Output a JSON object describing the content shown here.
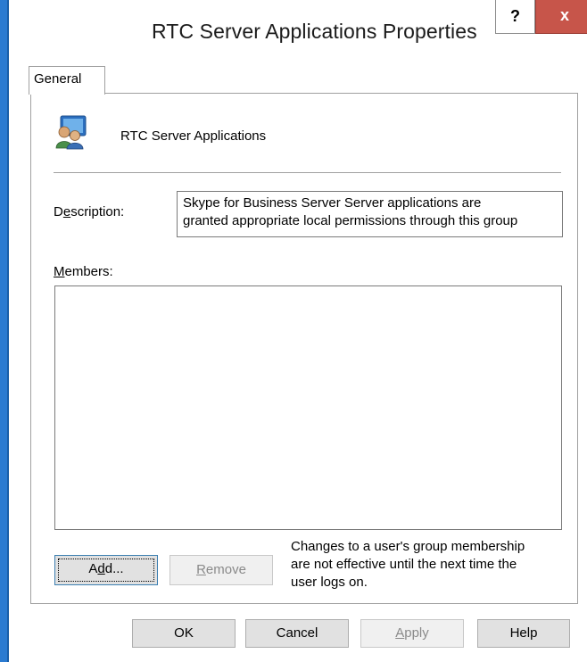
{
  "window": {
    "title": "RTC Server Applications Properties",
    "help_glyph": "?",
    "close_glyph": "x"
  },
  "tabs": [
    {
      "label": "General",
      "selected": true
    }
  ],
  "group": {
    "icon": "group-users-icon",
    "name": "RTC Server Applications"
  },
  "description": {
    "label_pre": "D",
    "label_underlined": "e",
    "label_post": "scription:",
    "line1": "Skype for Business Server Server applications are",
    "line2": "granted appropriate local permissions through this group"
  },
  "members": {
    "label_underlined": "M",
    "label_post": "embers:",
    "items": []
  },
  "buttons": {
    "add_pre": "A",
    "add_underlined": "d",
    "add_post": "d...",
    "remove_underlined": "R",
    "remove_post": "emove",
    "ok": "OK",
    "cancel": "Cancel",
    "apply_underlined": "A",
    "apply_post": "pply",
    "help": "Help"
  },
  "note": {
    "line1": "Changes to a user's group membership",
    "line2": "are not effective until the next time the",
    "line3": "user logs on."
  },
  "colors": {
    "frame_blue": "#2b7bd1",
    "close_red": "#c7554a"
  }
}
